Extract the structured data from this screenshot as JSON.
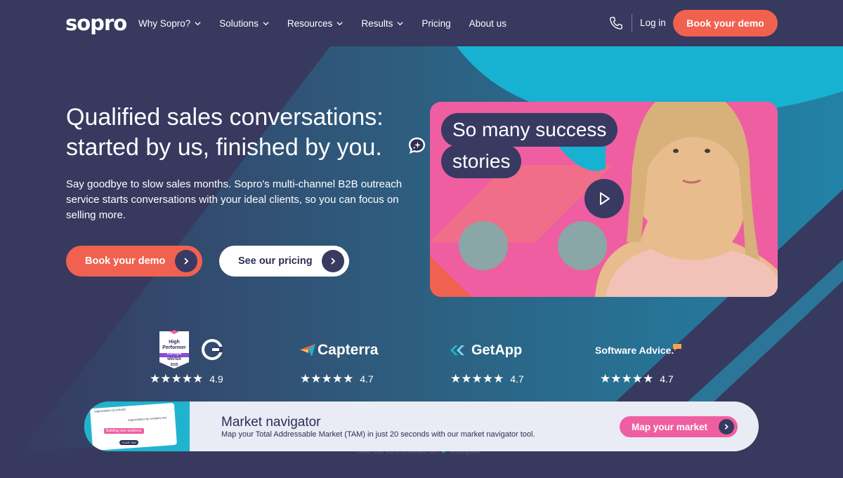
{
  "header": {
    "logo": "sopro",
    "nav": [
      {
        "label": "Why Sopro?",
        "has_dropdown": true
      },
      {
        "label": "Solutions",
        "has_dropdown": true
      },
      {
        "label": "Resources",
        "has_dropdown": true
      },
      {
        "label": "Results",
        "has_dropdown": true
      },
      {
        "label": "Pricing",
        "has_dropdown": false
      },
      {
        "label": "About us",
        "has_dropdown": false
      }
    ],
    "login": "Log in",
    "cta": "Book your demo"
  },
  "hero": {
    "title_line1": "Qualified sales conversations:",
    "title_line2": "started by us, finished by you.",
    "subtitle": "Say goodbye to slow sales months. Sopro's multi-channel B2B outreach service starts conversations with your ideal clients, so you can focus on selling more.",
    "primary_button": "Book your demo",
    "secondary_button": "See our pricing"
  },
  "video": {
    "caption_line1": "So many success",
    "caption_line2": "stories"
  },
  "reviews": [
    {
      "name": "G2",
      "badge_lines": [
        "High",
        "Performer",
        "Europe",
        "WINTER",
        "2025"
      ],
      "rating": "4.9"
    },
    {
      "name": "Capterra",
      "rating": "4.7"
    },
    {
      "name": "GetApp",
      "rating": "4.7"
    },
    {
      "name": "Software Advice.",
      "rating": "4.7"
    }
  ],
  "market": {
    "title": "Market navigator",
    "subtitle": "Map your Total Addressable Market (TAM) in just 20 seconds with our market navigator tool.",
    "button": "Map your market",
    "thumb_labels": [
      "Segmentation by industry",
      "Segmentation by company size",
      "Building your audience",
      "YOUR TAM"
    ]
  },
  "trustpilot": "See our 220 reviews on",
  "trustpilot_brand": "Trustpilot",
  "colors": {
    "background": "#37395f",
    "coral": "#f1614f",
    "pink": "#ef5ea0",
    "teal": "#1fb3d2",
    "navy": "#383a62"
  }
}
